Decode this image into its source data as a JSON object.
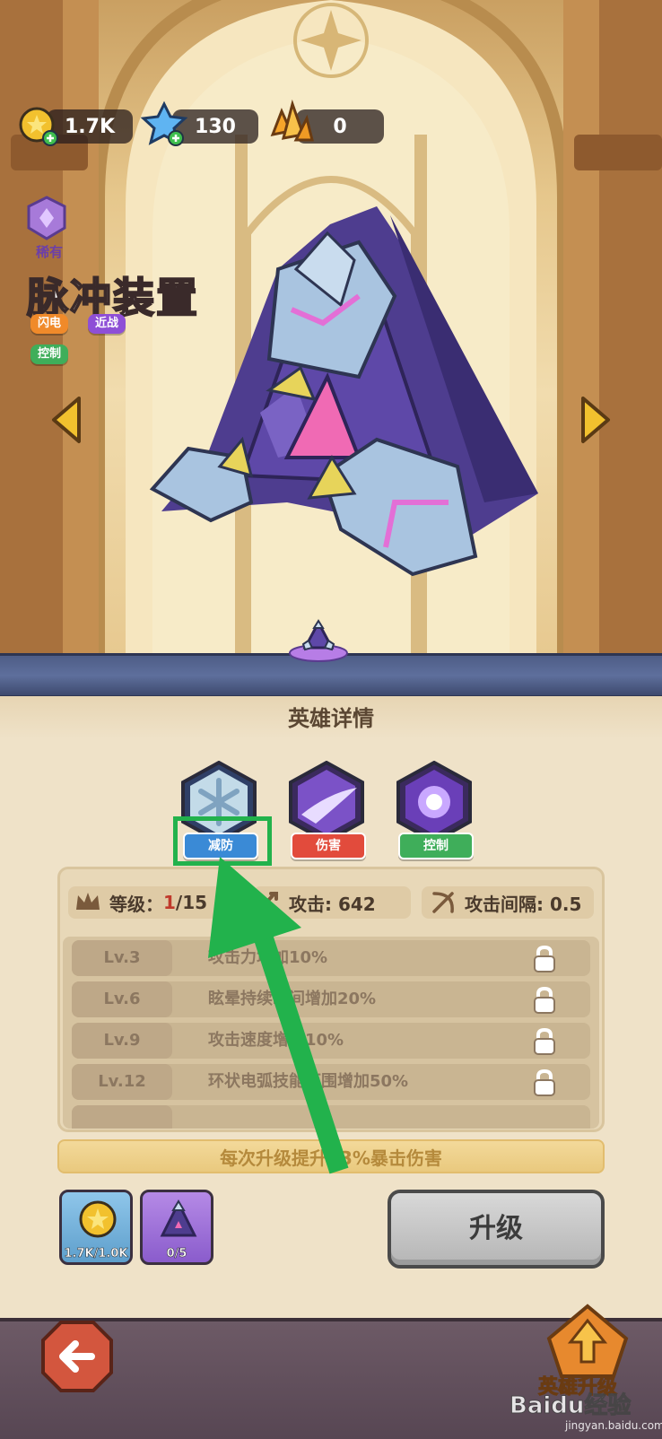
{
  "resources": {
    "gold": {
      "icon": "gold-coin-icon",
      "value": "1.7K"
    },
    "gems": {
      "icon": "blue-crystal-icon",
      "value": "130"
    },
    "shards": {
      "icon": "orange-crystal-icon",
      "value": "0"
    }
  },
  "hero": {
    "rarity": "稀有",
    "name": "脉冲装置",
    "tags": [
      {
        "label": "闪电",
        "color": "#f08a2a"
      },
      {
        "label": "近战",
        "color": "#8e4fd6"
      },
      {
        "label": "控制",
        "color": "#3fae5a"
      }
    ]
  },
  "panel": {
    "title": "英雄详情",
    "skills": [
      {
        "icon": "snowflake-skill-icon",
        "label": "减防",
        "color": "#3a8ad6"
      },
      {
        "icon": "slash-skill-icon",
        "label": "伤害",
        "color": "#e24b3c"
      },
      {
        "icon": "burst-skill-icon",
        "label": "控制",
        "color": "#3fae5a"
      }
    ],
    "stats": {
      "level_label": "等级：",
      "level_current": "1",
      "level_max": "/15",
      "attack_label": "攻击: 642",
      "interval_label": "攻击间隔: 0.5"
    },
    "levels": [
      {
        "lv": "Lv.3",
        "text": "攻击力增加10%"
      },
      {
        "lv": "Lv.6",
        "text": "眩晕持续时间增加20%"
      },
      {
        "lv": "Lv.9",
        "text": "攻击速度增加10%"
      },
      {
        "lv": "Lv.12",
        "text": "环状电弧技能范围增加50%"
      }
    ],
    "bonus": "每次升级提升13%暴击伤害",
    "costs": {
      "gold": "1.7K/1.0K",
      "shards": "0/5"
    },
    "upgrade_button": "升级"
  },
  "bottom_nav": {
    "upgrade_label": "英雄升级"
  },
  "watermark": {
    "main": "Baidu经验",
    "sub": "jingyan.baidu.com"
  },
  "colors": {
    "highlight": "#22b24c",
    "panel_bg": "#efe2c8",
    "divider": "#4e5d86"
  }
}
